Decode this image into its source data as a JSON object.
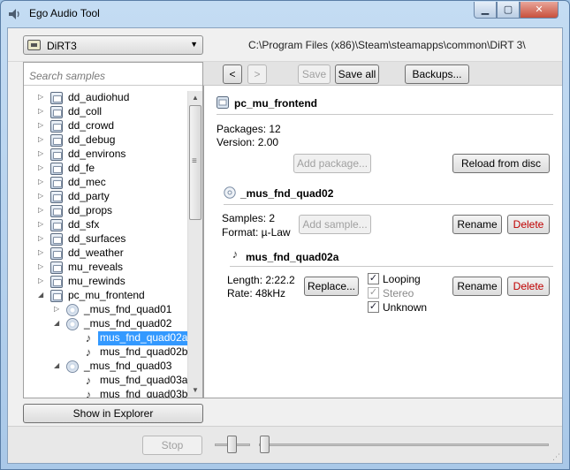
{
  "window": {
    "title": "Ego Audio Tool"
  },
  "header": {
    "game": "DiRT3",
    "path": "C:\\Program Files (x86)\\Steam\\steamapps\\common\\DiRT 3\\"
  },
  "search": {
    "placeholder": "Search samples"
  },
  "tree": {
    "items": [
      {
        "label": "dd_audiohud",
        "icon": "package-icon"
      },
      {
        "label": "dd_coll",
        "icon": "package-icon"
      },
      {
        "label": "dd_crowd",
        "icon": "package-icon"
      },
      {
        "label": "dd_debug",
        "icon": "package-icon"
      },
      {
        "label": "dd_environs",
        "icon": "package-icon"
      },
      {
        "label": "dd_fe",
        "icon": "package-icon"
      },
      {
        "label": "dd_mec",
        "icon": "package-icon"
      },
      {
        "label": "dd_party",
        "icon": "package-icon"
      },
      {
        "label": "dd_props",
        "icon": "package-icon"
      },
      {
        "label": "dd_sfx",
        "icon": "package-icon"
      },
      {
        "label": "dd_surfaces",
        "icon": "package-icon"
      },
      {
        "label": "dd_weather",
        "icon": "package-icon"
      },
      {
        "label": "mu_reveals",
        "icon": "package-icon"
      },
      {
        "label": "mu_rewinds",
        "icon": "package-icon"
      },
      {
        "label": "pc_mu_frontend",
        "icon": "package-icon"
      },
      {
        "label": "_mus_fnd_quad01",
        "icon": "disc-icon"
      },
      {
        "label": "_mus_fnd_quad02",
        "icon": "disc-icon"
      },
      {
        "label": "mus_fnd_quad02a",
        "icon": "music-note-icon"
      },
      {
        "label": "mus_fnd_quad02b",
        "icon": "music-note-icon"
      },
      {
        "label": "_mus_fnd_quad03",
        "icon": "disc-icon"
      },
      {
        "label": "mus_fnd_quad03a",
        "icon": "music-note-icon"
      },
      {
        "label": "mus_fnd_quad03b",
        "icon": "music-note-icon"
      }
    ],
    "selected": "mus_fnd_quad02a"
  },
  "left_footer": {
    "show_in_explorer": "Show in Explorer"
  },
  "toolbar": {
    "back": "<",
    "forward": ">",
    "save": "Save",
    "save_all": "Save all",
    "backups": "Backups..."
  },
  "package": {
    "name": "pc_mu_frontend",
    "packages": "Packages: 12",
    "version": "Version: 2.00",
    "add_package": "Add package...",
    "reload": "Reload from disc"
  },
  "bank": {
    "name": "_mus_fnd_quad02",
    "samples": "Samples: 2",
    "format": "Format: µ-Law",
    "add_sample": "Add sample...",
    "rename": "Rename",
    "delete": "Delete"
  },
  "sample": {
    "name": "mus_fnd_quad02a",
    "length": "Length: 2:22.2",
    "rate": "Rate: 48kHz",
    "replace": "Replace...",
    "looping": "Looping",
    "stereo": "Stereo",
    "unknown": "Unknown",
    "rename": "Rename",
    "delete": "Delete"
  },
  "player": {
    "stop": "Stop"
  }
}
